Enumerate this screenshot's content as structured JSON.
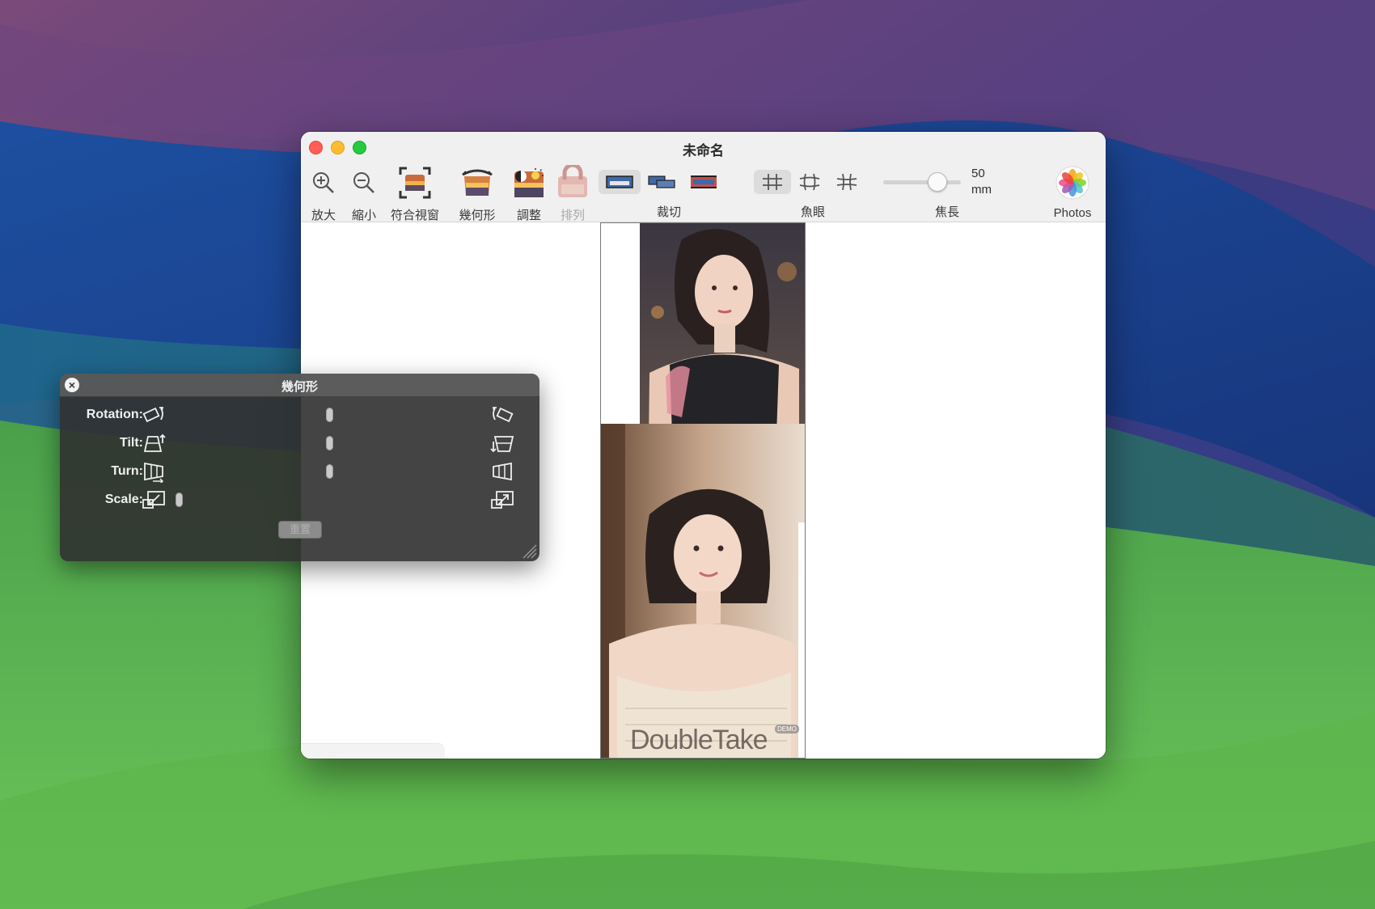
{
  "window": {
    "title": "未命名",
    "toolbar": {
      "zoom_in": "放大",
      "zoom_out": "縮小",
      "fit_view": "符合視窗",
      "geometry": "幾何形",
      "adjust": "調整",
      "arrange": "排列",
      "crop_group": "裁切",
      "fisheye_group": "魚眼",
      "focal_group": "焦長",
      "photos": "Photos",
      "focal_value": "50",
      "focal_unit": "mm"
    },
    "watermark": "DoubleTake",
    "watermark_badge": "DEMO"
  },
  "geometry_panel": {
    "title": "幾何形",
    "rows": [
      {
        "label": "Rotation:",
        "icon_left": "rotate-ccw-icon",
        "icon_right": "rotate-cw-icon"
      },
      {
        "label": "Tilt:",
        "icon_left": "tilt-back-icon",
        "icon_right": "tilt-forward-icon"
      },
      {
        "label": "Turn:",
        "icon_left": "turn-left-icon",
        "icon_right": "turn-right-icon"
      },
      {
        "label": "Scale:",
        "icon_left": "scale-down-icon",
        "icon_right": "scale-up-icon"
      }
    ],
    "reset_label": "重置"
  },
  "colors": {
    "accent_close": "#ff5f57",
    "accent_min": "#febc2e",
    "accent_max": "#28c840",
    "panel_bg": "#303030"
  }
}
